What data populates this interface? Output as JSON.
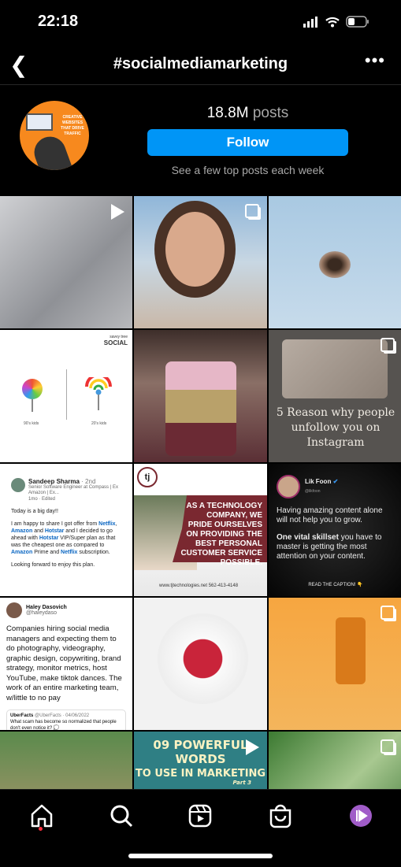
{
  "status": {
    "time": "22:18"
  },
  "header": {
    "title": "#socialmediamarketing"
  },
  "profile": {
    "avatar_text": "CREATIVE WEBSITES THAT DRIVE TRAFFIC",
    "post_count": "18.8M",
    "post_label": "posts",
    "follow_label": "Follow",
    "note": "See a few top posts each week"
  },
  "tiles": {
    "lollipop": {
      "brand_small": "savvy tree",
      "brand": "SOCIAL",
      "left_caption": "90's kids",
      "right_caption": "20's kids"
    },
    "reasons": {
      "caption": "5 Reason why people unfollow you on Instagram"
    },
    "linkedin": {
      "name": "Sandeep Sharma",
      "degree": "· 2nd",
      "headline": "Senior Software Engineer at Compass | Ex Amazon | Ex...",
      "meta": "1mo · Edited",
      "line1": "Today is a big day!!",
      "p1": "I am happy to share I got offer from",
      "netflix": "Netflix",
      "amazon": "Amazon",
      "and": "and",
      "hotstar": "Hotstar",
      "p2": "and I decided to go ahead with",
      "p3": "VIP/Super plan as that was the cheapest one as compared to",
      "p4": "Prime and",
      "p5": "subscription.",
      "line3": "Looking forward to enjoy this plan."
    },
    "tech": {
      "logo": "tj",
      "message": "As a technology company, we pride ourselves on providing the best personal customer service possible.",
      "footer": "www.tjtechnologies.net   562-413-4148"
    },
    "likfoon": {
      "name": "Lik Foon",
      "handle": "@likfoon",
      "p1": "Having amazing content alone will not help you to grow.",
      "bold": "One vital skillset",
      "p2": "you have to master is getting the most attention on your content.",
      "footer": "READ THE CAPTION! 👇"
    },
    "tweet": {
      "name": "Haley Dasovich",
      "handle": "@haleydaso",
      "body": "Companies hiring social media managers and expecting them to do photography, videography, graphic design, copywriting, brand strategy, monitor metrics, host YouTube, make tiktok dances. The work of an entire marketing team, w/little to no pay",
      "quote_name": "UberFacts",
      "quote_meta": "@UberFacts · 04/06/2022",
      "quote_body": "What scam has become so normalized that people don't even notice it? 💭"
    },
    "words": {
      "line1": "09 POWERFUL WORDS",
      "line2": "TO USE IN MARKETING",
      "part": "Part 3"
    }
  },
  "colors": {
    "accent": "#0095f6",
    "notification": "#ff3040",
    "profile_avatar": "#a05cc8"
  }
}
